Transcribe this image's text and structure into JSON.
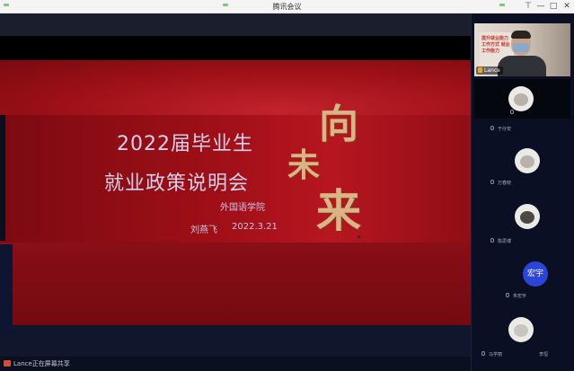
{
  "window": {
    "title": "腾讯会议",
    "controls": {
      "pin": "⊤",
      "minimize": "—",
      "maximize": "□",
      "close": "✕"
    }
  },
  "slide": {
    "title_line1": "2022届毕业生",
    "title_line2": "就业政策说明会",
    "department": "外国语学院",
    "author": "刘燕飞",
    "date": "2022.3.21",
    "calligraphy": [
      "向",
      "未",
      "来"
    ]
  },
  "share_bar": {
    "text": "Lance正在屏幕共享"
  },
  "participants": {
    "active": {
      "name": "Lance",
      "sign_text": "提升就业能力 工作方式 就业工作能力"
    },
    "list": [
      {
        "name": "于仔安"
      },
      {
        "name": "万春晓"
      },
      {
        "name": "陈思博"
      },
      {
        "name": "朱宏宇",
        "avatar_text": "宏宇"
      },
      {
        "name": "马学丽"
      },
      {
        "name": "李恒"
      }
    ]
  },
  "colors": {
    "slide_red": "#a0101a",
    "calligraphy_gold": "#d9b484",
    "panel_bg": "#0b0f23",
    "avatar_blue": "#2a45d8"
  }
}
